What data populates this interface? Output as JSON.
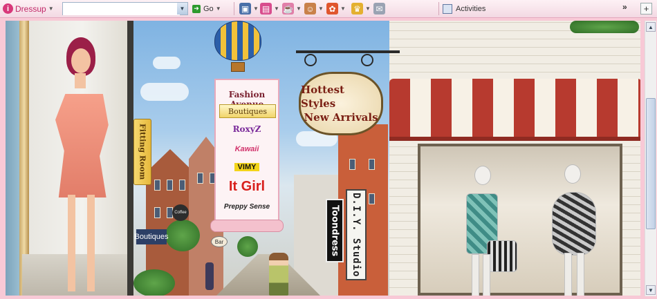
{
  "toolbar": {
    "brand": "Dressup",
    "search_value": "",
    "go_label": "Go",
    "activities_label": "Activities",
    "more_label": "»",
    "icons": [
      "photo-icon",
      "gift-icon",
      "teapot-icon",
      "avatar-icon",
      "palette-icon",
      "crown-icon",
      "mail-icon"
    ]
  },
  "scene": {
    "fitting_room_label": "Fitting Room",
    "fashion_avenue": {
      "title": "Fashion Avenue",
      "boutiques_label": "Boutiques",
      "shops": [
        "RoxyZ",
        "Kawaii",
        "VIMY",
        "It Girl",
        "Preppy Sense"
      ]
    },
    "hanging_sign": [
      "Hottest Styles",
      "New Arrivals"
    ],
    "toondress_label": "Toondress",
    "diy_label": "D.I.Y. Studio",
    "street_signs": [
      "Coffee",
      "Bar",
      "Boutiques"
    ]
  },
  "colors": {
    "toolbar_bg": "#f3d9e3",
    "frame_pink": "#f8c9d6",
    "awning_red": "#b73a2f",
    "brand_pink": "#d8387a"
  }
}
